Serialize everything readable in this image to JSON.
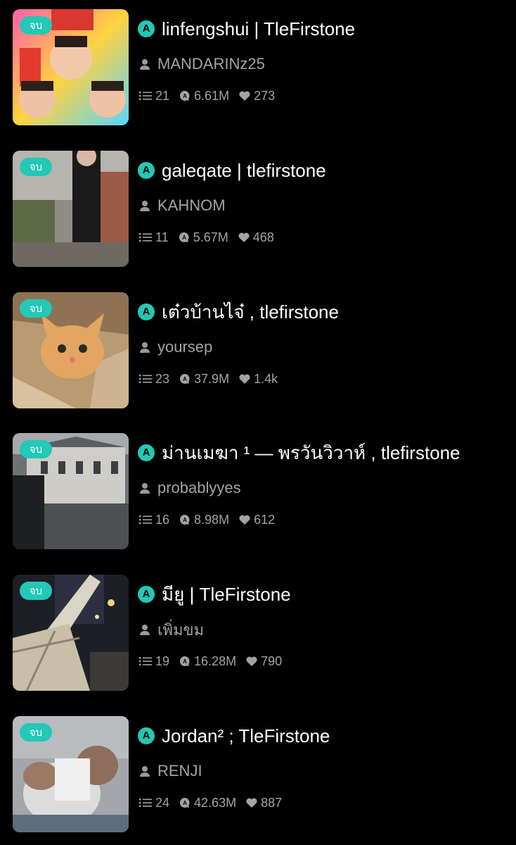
{
  "colors": {
    "background": "#000000",
    "accent": "#23c8b6",
    "muted_text": "#a3a3a3"
  },
  "icons": {
    "parts": "list-icon",
    "reads": "eye-bubble-icon",
    "votes": "heart-icon",
    "author": "person-icon",
    "title_marker": "a-circle-icon"
  },
  "stories": [
    {
      "badge": "จบ",
      "title": "linfengshui | TleFirstone",
      "author": "MANDARINz25",
      "parts": "21",
      "reads": "6.61M",
      "votes": "273"
    },
    {
      "badge": "จบ",
      "title": "galeqate | tlefirstone",
      "author": "KAHNOM",
      "parts": "11",
      "reads": "5.67M",
      "votes": "468"
    },
    {
      "badge": "จบ",
      "title": "เต๋วบ้านไจ๋ , tlefirstone",
      "author": "yoursep",
      "parts": "23",
      "reads": "37.9M",
      "votes": "1.4k"
    },
    {
      "badge": "จบ",
      "title": "ม่านเมฆา ¹ — พรวันวิวาห์  , tlefirstone",
      "author": "probablyyes",
      "parts": "16",
      "reads": "8.98M",
      "votes": "612"
    },
    {
      "badge": "จบ",
      "title": "มียู | TleFirstone",
      "author": "เพิ่มขม",
      "parts": "19",
      "reads": "16.28M",
      "votes": "790"
    },
    {
      "badge": "จบ",
      "title": "Jordan² ; TleFirstone",
      "author": "RENJI",
      "parts": "24",
      "reads": "42.63M",
      "votes": "887"
    }
  ]
}
